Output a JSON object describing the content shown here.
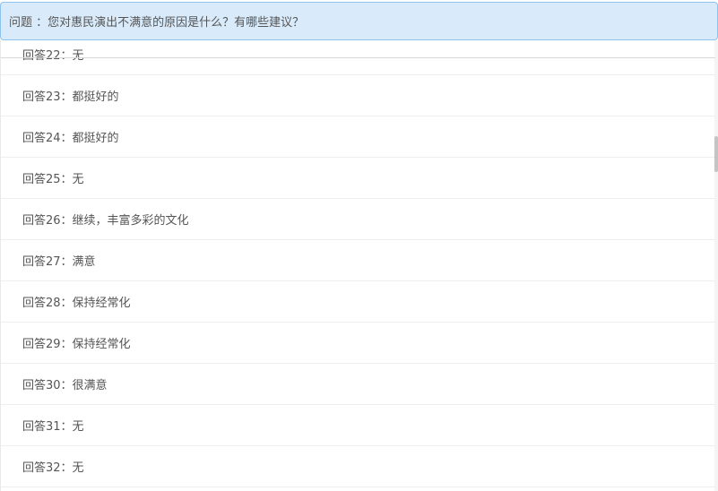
{
  "question": {
    "text": "问题 ：您对惠民演出不满意的原因是什么？有哪些建议？"
  },
  "answers": [
    {
      "label": "回答22：无"
    },
    {
      "label": "回答23：都挺好的"
    },
    {
      "label": "回答24：都挺好的"
    },
    {
      "label": "回答25：无"
    },
    {
      "label": "回答26：继续，丰富多彩的文化"
    },
    {
      "label": "回答27：满意"
    },
    {
      "label": "回答28：保持经常化"
    },
    {
      "label": "回答29：保持经常化"
    },
    {
      "label": "回答30：很满意"
    },
    {
      "label": "回答31：无"
    },
    {
      "label": "回答32：无"
    }
  ],
  "colors": {
    "header_background": "#d9ebfa",
    "header_border": "#8dc3ec",
    "text": "#555555"
  }
}
